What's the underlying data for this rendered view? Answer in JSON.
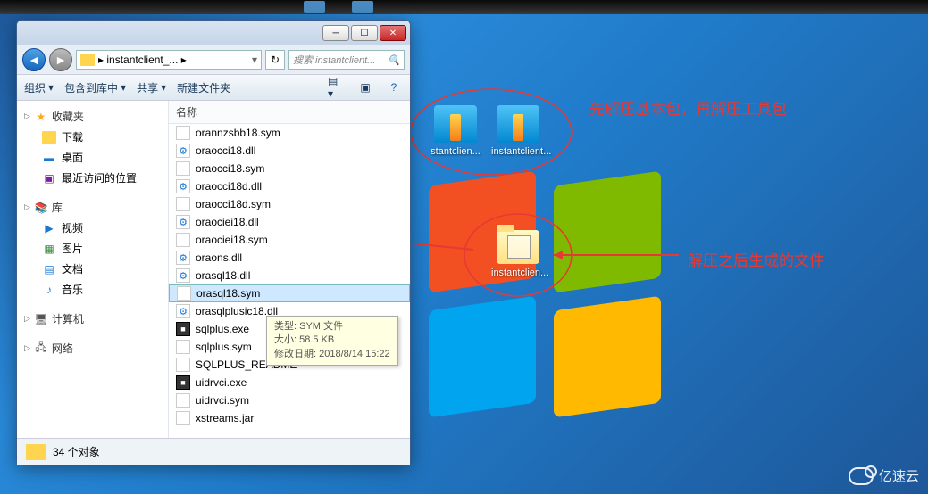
{
  "annotations": {
    "top": "先解压基本包，再解压工具包",
    "right": "解压之后生成的文件"
  },
  "desktop_icons": {
    "zip1": "stantclien...",
    "zip2": "instantclient...",
    "folder1": "instantclien..."
  },
  "window": {
    "path": "instantclient_...",
    "path_sep": "▸",
    "search_placeholder": "搜索 instantclient...",
    "toolbar": {
      "organize": "组织",
      "include": "包含到库中",
      "share": "共享",
      "newfolder": "新建文件夹"
    },
    "nav": {
      "favorites": "收藏夹",
      "downloads": "下载",
      "desktop": "桌面",
      "recent": "最近访问的位置",
      "libraries": "库",
      "videos": "视频",
      "pictures": "图片",
      "documents": "文档",
      "music": "音乐",
      "computer": "计算机",
      "network": "网络"
    },
    "files_header": "名称",
    "files": [
      "orannzsbb18.sym",
      "oraocci18.dll",
      "oraocci18.sym",
      "oraocci18d.dll",
      "oraocci18d.sym",
      "oraociei18.dll",
      "oraociei18.sym",
      "oraons.dll",
      "orasql18.dll",
      "orasql18.sym",
      "orasqlplusic18.dll",
      "sqlplus.exe",
      "sqlplus.sym",
      "SQLPLUS_README",
      "uidrvci.exe",
      "uidrvci.sym",
      "xstreams.jar"
    ],
    "selected_index": 9,
    "tooltip": {
      "type": "类型: SYM 文件",
      "size": "大小: 58.5 KB",
      "date": "修改日期: 2018/8/14 15:22"
    },
    "status": "34 个对象"
  },
  "watermark": "亿速云"
}
